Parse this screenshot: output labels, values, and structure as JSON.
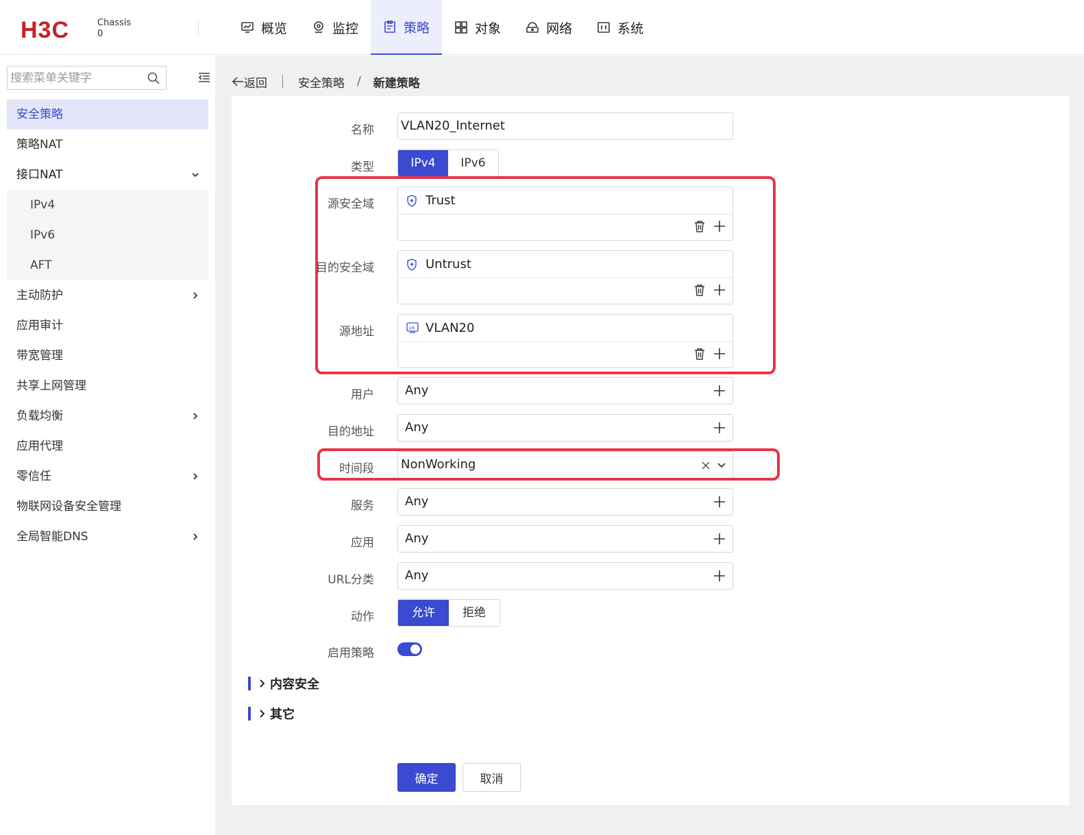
{
  "header": {
    "brand": "H3C",
    "chassis_line1": "Chassis",
    "chassis_line2": "0",
    "nav": [
      {
        "label": "概览",
        "icon": "monitor-chart-icon"
      },
      {
        "label": "监控",
        "icon": "location-pin-icon"
      },
      {
        "label": "策略",
        "icon": "clipboard-icon",
        "active": true
      },
      {
        "label": "对象",
        "icon": "grid-icon"
      },
      {
        "label": "网络",
        "icon": "network-icon"
      },
      {
        "label": "系统",
        "icon": "system-icon"
      }
    ]
  },
  "sidebar": {
    "search_placeholder": "搜索菜单关键字",
    "items": [
      {
        "label": "安全策略",
        "active": true
      },
      {
        "label": "策略NAT"
      },
      {
        "label": "接口NAT",
        "expanded": true
      },
      {
        "label": "IPv4",
        "sub": true
      },
      {
        "label": "IPv6",
        "sub": true
      },
      {
        "label": "AFT",
        "sub": true
      },
      {
        "label": "主动防护",
        "has_children": true
      },
      {
        "label": "应用审计"
      },
      {
        "label": "带宽管理"
      },
      {
        "label": "共享上网管理"
      },
      {
        "label": "负载均衡",
        "has_children": true
      },
      {
        "label": "应用代理"
      },
      {
        "label": "零信任",
        "has_children": true
      },
      {
        "label": "物联网设备安全管理"
      },
      {
        "label": "全局智能DNS",
        "has_children": true
      }
    ]
  },
  "breadcrumb": {
    "back": "返回",
    "parent": "安全策略",
    "separator": "/",
    "current": "新建策略"
  },
  "form": {
    "name_label": "名称",
    "name_value": "VLAN20_Internet",
    "type_label": "类型",
    "type_options": [
      "IPv4",
      "IPv6"
    ],
    "type_selected": "IPv4",
    "src_zone_label": "源安全域",
    "src_zone_value": "Trust",
    "dst_zone_label": "目的安全域",
    "dst_zone_value": "Untrust",
    "src_addr_label": "源地址",
    "src_addr_value": "VLAN20",
    "user_label": "用户",
    "user_value": "Any",
    "dst_addr_label": "目的地址",
    "dst_addr_value": "Any",
    "time_label": "时间段",
    "time_value": "NonWorking",
    "service_label": "服务",
    "service_value": "Any",
    "app_label": "应用",
    "app_value": "Any",
    "url_label": "URL分类",
    "url_value": "Any",
    "action_label": "动作",
    "action_options": [
      "允许",
      "拒绝"
    ],
    "action_selected": "允许",
    "enable_label": "启用策略",
    "enable_on": true
  },
  "sections": [
    {
      "title": "内容安全"
    },
    {
      "title": "其它"
    }
  ],
  "buttons": {
    "confirm": "确定",
    "cancel": "取消"
  },
  "colors": {
    "accent": "#3a4ad1",
    "highlight": "#e8344a",
    "brand_red": "#c8202a"
  }
}
